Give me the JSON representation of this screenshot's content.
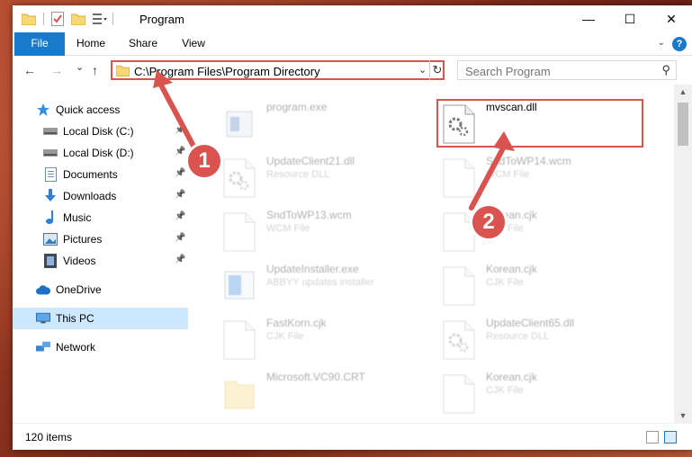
{
  "window": {
    "title": "Program",
    "minimize": "—",
    "maximize": "☐",
    "close": "✕"
  },
  "ribbon": {
    "tabs": [
      "File",
      "Home",
      "Share",
      "View"
    ],
    "help": "?"
  },
  "navbar": {
    "back": "←",
    "forward": "→",
    "recent": "⌄",
    "up": "↑",
    "address": "C:\\Program Files\\Program Directory",
    "dropdown": "⌄",
    "refresh": "↻",
    "search_placeholder": "Search Program"
  },
  "sidebar": {
    "items": [
      {
        "label": "Quick access",
        "icon": "star-icon",
        "pinned": false
      },
      {
        "label": "Local Disk (C:)",
        "icon": "drive-icon",
        "pinned": true
      },
      {
        "label": "Local Disk (D:)",
        "icon": "drive-icon",
        "pinned": true
      },
      {
        "label": "Documents",
        "icon": "documents-icon",
        "pinned": true
      },
      {
        "label": "Downloads",
        "icon": "downloads-icon",
        "pinned": true
      },
      {
        "label": "Music",
        "icon": "music-icon",
        "pinned": true
      },
      {
        "label": "Pictures",
        "icon": "pictures-icon",
        "pinned": true
      },
      {
        "label": "Videos",
        "icon": "videos-icon",
        "pinned": true
      },
      {
        "label": "OneDrive",
        "icon": "cloud-icon",
        "pinned": false
      },
      {
        "label": "This PC",
        "icon": "computer-icon",
        "pinned": false,
        "selected": true
      },
      {
        "label": "Network",
        "icon": "network-icon",
        "pinned": false
      }
    ]
  },
  "files": [
    {
      "name": "program.exe",
      "type": "",
      "icon": "exe-icon",
      "faded": true
    },
    {
      "name": "mvscan.dll",
      "type": "",
      "icon": "dll-icon",
      "faded": false
    },
    {
      "name": "UpdateClient21.dll",
      "type": "Resource DLL",
      "icon": "dll-icon",
      "faded": true
    },
    {
      "name": "SndToWP14.wcm",
      "type": "WCM File",
      "icon": "file-icon",
      "faded": true
    },
    {
      "name": "SndToWP13.wcm",
      "type": "WCM File",
      "icon": "file-icon",
      "faded": true
    },
    {
      "name": "Korean.cjk",
      "type": "CJK File",
      "icon": "file-icon",
      "faded": true
    },
    {
      "name": "UpdateInstaller.exe",
      "type": "ABBYY updates installer",
      "icon": "installer-icon",
      "faded": true
    },
    {
      "name": "Korean.cjk",
      "type": "CJK File",
      "icon": "file-icon",
      "faded": true
    },
    {
      "name": "FastKorn.cjk",
      "type": "CJK File",
      "icon": "file-icon",
      "faded": true
    },
    {
      "name": "UpdateClient65.dll",
      "type": "Resource DLL",
      "icon": "dll-icon",
      "faded": true
    },
    {
      "name": "Microsoft.VC90.CRT",
      "type": "",
      "icon": "folder-icon",
      "faded": true
    },
    {
      "name": "Korean.cjk",
      "type": "CJK File",
      "icon": "file-icon",
      "faded": true
    }
  ],
  "status": {
    "count": "120 items"
  },
  "annotations": {
    "badge1": "1",
    "badge2": "2",
    "color": "#d9534f"
  }
}
